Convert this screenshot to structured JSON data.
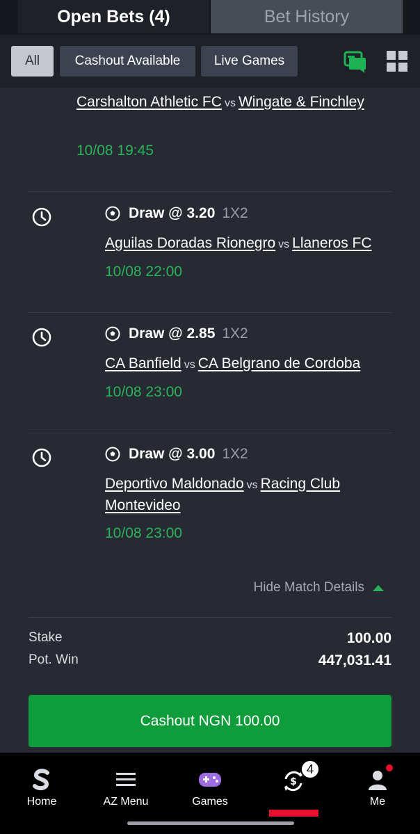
{
  "tabs": {
    "open_bets": "Open Bets (4)",
    "bet_history": "Bet History"
  },
  "filters": {
    "all": "All",
    "cashout": "Cashout Available",
    "live": "Live Games"
  },
  "legs": [
    {
      "selection": "",
      "market": "",
      "home": "Carshalton Athletic FC",
      "vs": "vs",
      "away": "Wingate & Finchley",
      "time": "10/08 19:45"
    },
    {
      "selection": "Draw @ 3.20",
      "market": "1X2",
      "home": "Aguilas Doradas Rionegro",
      "vs": "vs",
      "away": "Llaneros FC",
      "time": "10/08 22:00"
    },
    {
      "selection": "Draw @ 2.85",
      "market": "1X2",
      "home": "CA Banfield",
      "vs": "vs",
      "away": "CA Belgrano de Cordoba",
      "time": "10/08 23:00"
    },
    {
      "selection": "Draw @ 3.00",
      "market": "1X2",
      "home": "Deportivo Maldonado",
      "vs": "vs",
      "away": "Racing Club Montevideo",
      "time": "10/08 23:00"
    }
  ],
  "hide_details": "Hide Match Details",
  "totals": {
    "stake_label": "Stake",
    "stake_value": "100.00",
    "potwin_label": "Pot. Win",
    "potwin_value": "447,031.41"
  },
  "cashout_button": "Cashout NGN 100.00",
  "nav": {
    "home": "Home",
    "az_menu": "AZ Menu",
    "games": "Games",
    "open_bets_badge": "4",
    "me": "Me"
  },
  "colors": {
    "accent_green": "#29b35a",
    "button_green": "#0f9d3c",
    "active_red": "#e8102e"
  }
}
